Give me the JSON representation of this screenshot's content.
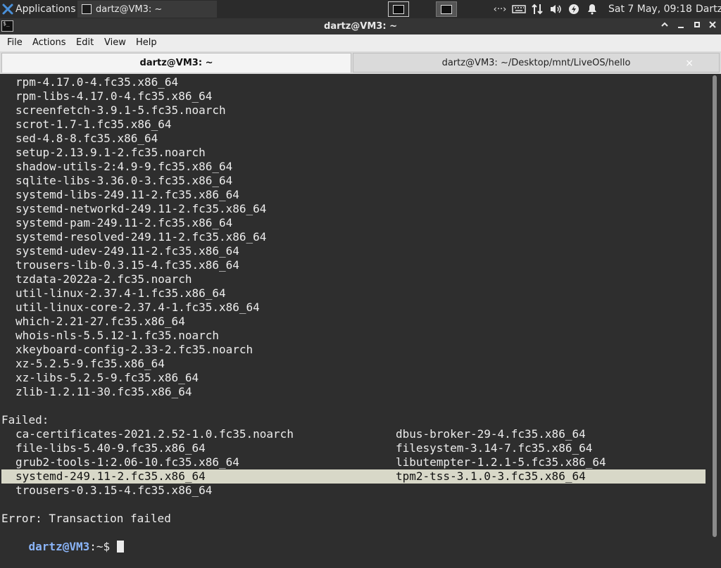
{
  "panel": {
    "applications_label": "Applications",
    "task_label": "dartz@VM3: ~",
    "clock": "Sat  7 May, 09:18",
    "user": "Dartz"
  },
  "window": {
    "title": "dartz@VM3: ~"
  },
  "menubar": {
    "items": [
      "File",
      "Actions",
      "Edit",
      "View",
      "Help"
    ]
  },
  "tabs": [
    {
      "label": "dartz@VM3: ~",
      "active": true
    },
    {
      "label": "dartz@VM3: ~/Desktop/mnt/LiveOS/hello",
      "active": false,
      "close": "×"
    }
  ],
  "terminal": {
    "packages": [
      "rpm-4.17.0-4.fc35.x86_64",
      "rpm-libs-4.17.0-4.fc35.x86_64",
      "screenfetch-3.9.1-5.fc35.noarch",
      "scrot-1.7-1.fc35.x86_64",
      "sed-4.8-8.fc35.x86_64",
      "setup-2.13.9.1-2.fc35.noarch",
      "shadow-utils-2:4.9-9.fc35.x86_64",
      "sqlite-libs-3.36.0-3.fc35.x86_64",
      "systemd-libs-249.11-2.fc35.x86_64",
      "systemd-networkd-249.11-2.fc35.x86_64",
      "systemd-pam-249.11-2.fc35.x86_64",
      "systemd-resolved-249.11-2.fc35.x86_64",
      "systemd-udev-249.11-2.fc35.x86_64",
      "trousers-lib-0.3.15-4.fc35.x86_64",
      "tzdata-2022a-2.fc35.noarch",
      "util-linux-2.37.4-1.fc35.x86_64",
      "util-linux-core-2.37.4-1.fc35.x86_64",
      "which-2.21-27.fc35.x86_64",
      "whois-nls-5.5.12-1.fc35.noarch",
      "xkeyboard-config-2.33-2.fc35.noarch",
      "xz-5.2.5-9.fc35.x86_64",
      "xz-libs-5.2.5-9.fc35.x86_64",
      "zlib-1.2.11-30.fc35.x86_64"
    ],
    "failed_header": "Failed:",
    "failed_rows": [
      [
        "ca-certificates-2021.2.52-1.0.fc35.noarch",
        "dbus-broker-29-4.fc35.x86_64"
      ],
      [
        "file-libs-5.40-9.fc35.x86_64",
        "filesystem-3.14-7.fc35.x86_64"
      ],
      [
        "grub2-tools-1:2.06-10.fc35.x86_64",
        "libutempter-1.2.1-5.fc35.x86_64"
      ],
      [
        "systemd-249.11-2.fc35.x86_64",
        "tpm2-tss-3.1.0-3.fc35.x86_64"
      ],
      [
        "trousers-0.3.15-4.fc35.x86_64",
        ""
      ]
    ],
    "error": "Error: Transaction failed",
    "prompt_user": "dartz@VM3",
    "prompt_suffix": ":~$ "
  },
  "colors": {
    "highlight": "#d8d8c8",
    "prompt": "#8ab4f8"
  }
}
